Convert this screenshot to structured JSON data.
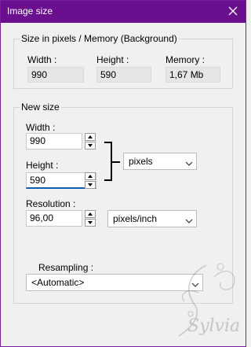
{
  "window": {
    "title": "Image size",
    "close_icon": "close-icon"
  },
  "current": {
    "legend": "Size in pixels / Memory (Background)",
    "width_label": "Width :",
    "width_value": "990",
    "height_label": "Height :",
    "height_value": "590",
    "memory_label": "Memory :",
    "memory_value": "1,67 Mb"
  },
  "new_size": {
    "legend": "New size",
    "width_label": "Width :",
    "width_value": "990",
    "height_label": "Height :",
    "height_value": "590",
    "units_selected": "pixels",
    "resolution_label": "Resolution :",
    "resolution_value": "96,00",
    "resolution_unit_selected": "pixels/inch",
    "resampling_label": "Resampling :",
    "resampling_selected": "<Automatic>"
  },
  "watermark": {
    "text": "Sylvia"
  },
  "colors": {
    "titlebar": "#6a0f8e",
    "focus": "#0a5fb4"
  }
}
